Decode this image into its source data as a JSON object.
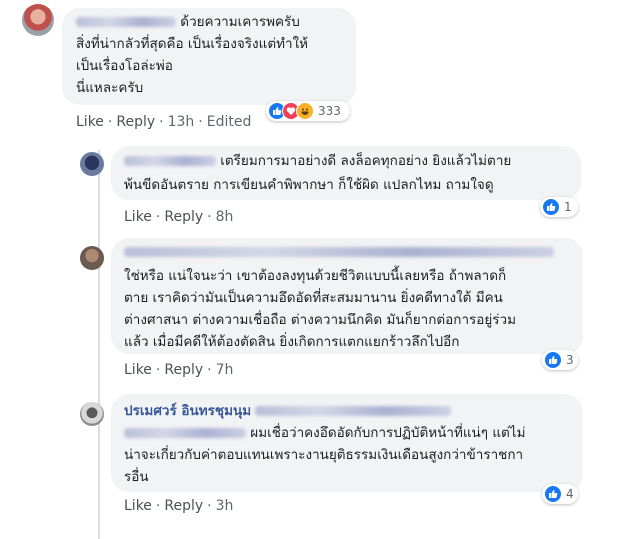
{
  "comments": [
    {
      "lines": [
        "ด้วยความเคารพครับ",
        "สิ่งที่น่ากลัวที่สุดคือ เป็นเรื่องจริงแต่ทำให้",
        "เป็นเรื่องโอล่ะพ่อ",
        "นี่แหละครับ"
      ],
      "reaction_count": "333",
      "actions": {
        "like": "Like",
        "reply": "Reply",
        "time": "13h",
        "edited": "Edited"
      }
    },
    {
      "lines": [
        "เตรียมการมาอย่างดี ลงล็อคทุกอย่าง ยิงแล้วไม่ตาย",
        "พ้นขีดอันตราย การเขียนคำพิพากษา ก็ใช้ผิด แปลกไหม ถามใจดู"
      ],
      "reaction_count": "1",
      "actions": {
        "like": "Like",
        "reply": "Reply",
        "time": "8h"
      }
    },
    {
      "lines": [
        "ใช่หรือ แน่ใจนะว่า เขาต้องลงทุนด้วยชีวิตแบบนี้เลยหรือ ถ้าพลาดก็",
        "ตาย เราคิดว่ามันเป็นความอึดอัดที่สะสมมานาน ยิ่งคดีทางใต้ มีคน",
        "ต่างศาสนา ต่างความเชื่อถือ ต่างความนึกคิด มันก็ยากต่อการอยู่ร่วม",
        "แล้ว เมื่อมีคดีให้ต้องตัดสิน ยิ่งเกิดการแตกแยกร้าวลึกไปอีก"
      ],
      "reaction_count": "3",
      "actions": {
        "like": "Like",
        "reply": "Reply",
        "time": "7h"
      }
    },
    {
      "author": "ปรเมศวร์ อินทรชุมนุม",
      "lines": [
        "ผมเชื่อว่าคงอึดอัดกับการปฏิบัติหน้าที่แน่ๆ แต่ไม่",
        "น่าจะเกี่ยวกับค่าตอบแทนเพราะงานยุติธรรมเงินเดือนสูงกว่าข้าราชกา",
        "รอื่น"
      ],
      "reaction_count": "4",
      "actions": {
        "like": "Like",
        "reply": "Reply",
        "time": "3h"
      }
    }
  ],
  "colors": {
    "bubble": "#f2f3f5",
    "link": "#385898",
    "like_blue": "#1877f2",
    "meta": "#606770"
  },
  "icons": [
    "avatar",
    "like-icon",
    "love-icon",
    "haha-icon"
  ]
}
